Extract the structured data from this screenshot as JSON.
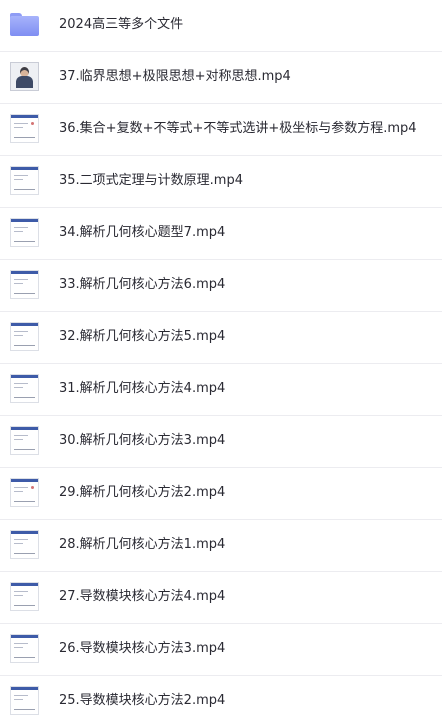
{
  "folder": {
    "name": "2024高三等多个文件",
    "icon": "folder-icon",
    "color": "#8f9cf5"
  },
  "files": [
    {
      "name": "37.临界思想+极限思想+对称思想.mp4",
      "thumb": "presenter"
    },
    {
      "name": "36.集合+复数+不等式+不等式选讲+极坐标与参数方程.mp4",
      "thumb": "slide"
    },
    {
      "name": "35.二项式定理与计数原理.mp4",
      "thumb": "slide"
    },
    {
      "name": "34.解析几何核心题型7.mp4",
      "thumb": "slide"
    },
    {
      "name": "33.解析几何核心方法6.mp4",
      "thumb": "slide"
    },
    {
      "name": "32.解析几何核心方法5.mp4",
      "thumb": "slide"
    },
    {
      "name": "31.解析几何核心方法4.mp4",
      "thumb": "slide"
    },
    {
      "name": "30.解析几何核心方法3.mp4",
      "thumb": "slide"
    },
    {
      "name": "29.解析几何核心方法2.mp4",
      "thumb": "slide"
    },
    {
      "name": "28.解析几何核心方法1.mp4",
      "thumb": "slide"
    },
    {
      "name": "27.导数模块核心方法4.mp4",
      "thumb": "slide"
    },
    {
      "name": "26.导数模块核心方法3.mp4",
      "thumb": "slide"
    },
    {
      "name": "25.导数模块核心方法2.mp4",
      "thumb": "slide"
    }
  ],
  "colors": {
    "accent": "#3e5ba8",
    "divider": "#ececf0",
    "text": "#2a2a33"
  }
}
